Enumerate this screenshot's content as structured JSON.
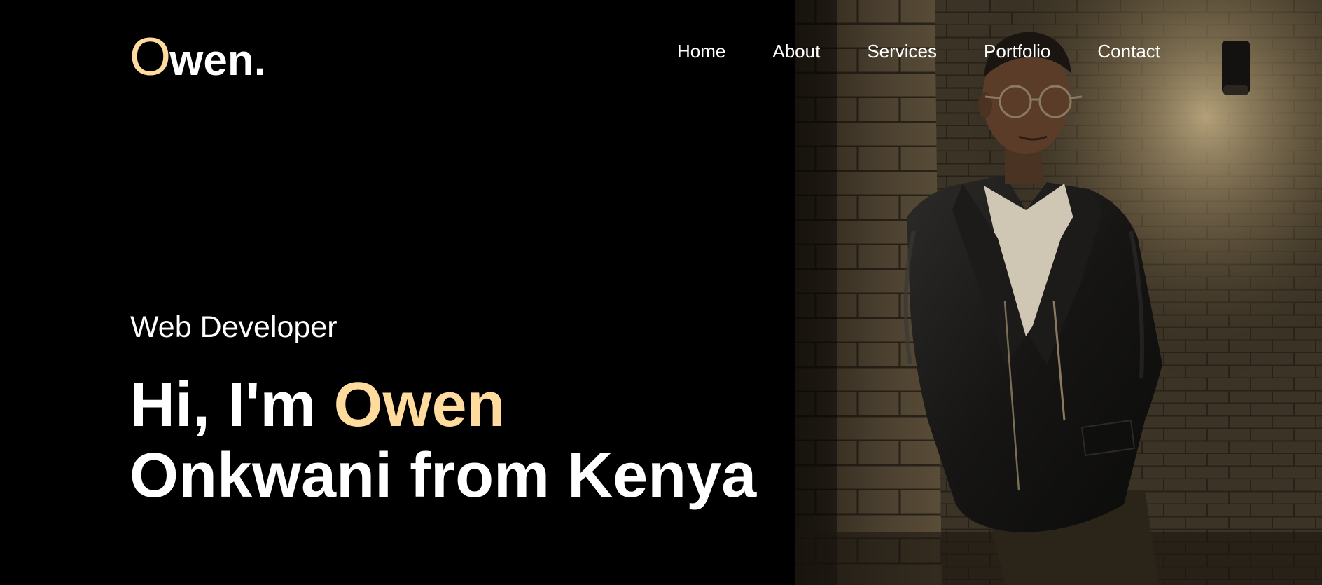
{
  "colors": {
    "background": "#000000",
    "accent": "#ffdb9e",
    "text": "#ffffff"
  },
  "logo": {
    "initial": "O",
    "rest": "wen."
  },
  "nav": {
    "items": [
      {
        "label": "Home"
      },
      {
        "label": "About"
      },
      {
        "label": "Services"
      },
      {
        "label": "Portfolio"
      },
      {
        "label": "Contact"
      }
    ]
  },
  "hero": {
    "subtitle": "Web Developer",
    "title_greeting": "Hi, I'm",
    "title_name": "Owen",
    "title_line2": "Onkwani from Kenya"
  }
}
